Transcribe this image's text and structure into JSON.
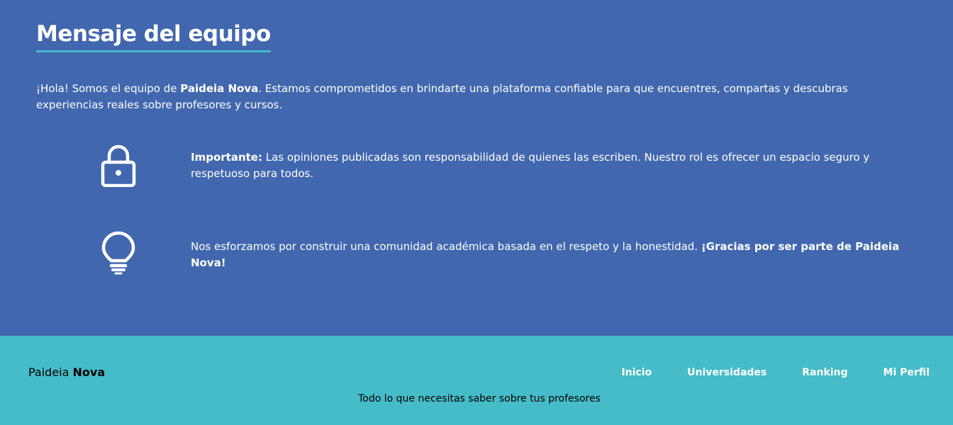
{
  "message_section": {
    "title": "Mensaje del equipo",
    "intro": {
      "prefix": "¡Hola! Somos el equipo de ",
      "brand": "Paideia Nova",
      "suffix": ". Estamos comprometidos en brindarte una plataforma confiable para que encuentres, compartas y descubras experiencias reales sobre profesores y cursos."
    },
    "notes": [
      {
        "icon": "lock-icon",
        "bold_lead": "Importante:",
        "text": " Las opiniones publicadas son responsabilidad de quienes las escriben. Nuestro rol es ofrecer un espacio seguro y respetuoso para todos."
      },
      {
        "icon": "lightbulb-icon",
        "text": "Nos esforzamos por construir una comunidad académica basada en el respeto y la honestidad. ",
        "bold_tail": "¡Gracias por ser parte de Paideia Nova!"
      }
    ]
  },
  "footer": {
    "brand_light": "Paideia ",
    "brand_bold": "Nova",
    "nav": [
      "Inicio",
      "Universidades",
      "Ranking",
      "Mi Perfil"
    ],
    "tagline": "Todo lo que necesitas saber sobre tus profesores"
  },
  "colors": {
    "section_bg": "#4167ae",
    "footer_bg": "#46bcc8",
    "accent_underline": "#46bcc9",
    "text": "#ffffff"
  }
}
